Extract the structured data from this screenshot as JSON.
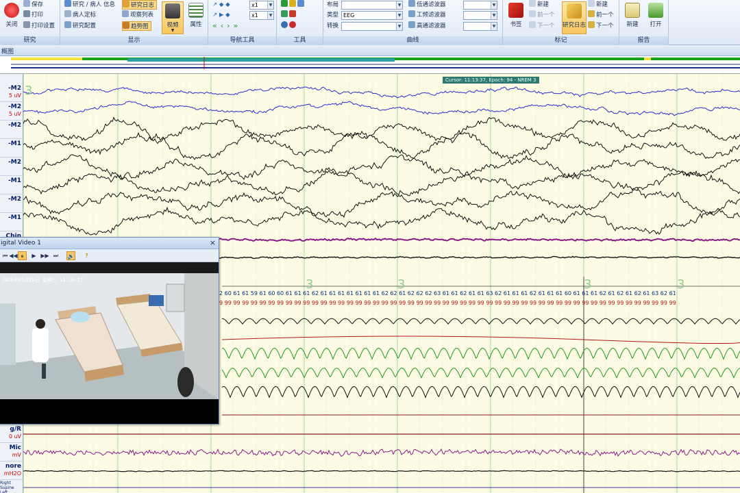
{
  "ribbon": {
    "groups": [
      {
        "label": "研究",
        "items": [
          "关闭",
          "保存",
          "打印",
          "打印设置"
        ]
      },
      {
        "label": "显示",
        "items": [
          "研究 / 病人 信息",
          "病人定标",
          "研究配置",
          "研究日志",
          "观察列表",
          "趋势图",
          "视频",
          "属性"
        ]
      },
      {
        "label": "导航工具",
        "items": [
          "x1",
          "x1"
        ]
      },
      {
        "label": "工具",
        "items": []
      },
      {
        "label": "曲线",
        "items": [
          "布局",
          "类型",
          "EEG",
          "转换",
          "低通滤波器",
          "工频滤波器",
          "高通滤波器"
        ]
      },
      {
        "label": "标记",
        "items": [
          "书签",
          "前一个",
          "下一个",
          "研究日志",
          "新建",
          "前一个",
          "下一个"
        ]
      },
      {
        "label": "报告",
        "items": [
          "新建",
          "打开"
        ]
      }
    ]
  },
  "overview": {
    "label": "概图"
  },
  "cursor_label": "Cursor: 11:13:37, Epoch: 94 - NREM 3",
  "epoch_stage_markers": [
    "3",
    "3",
    "3",
    "3",
    "3"
  ],
  "channels": [
    {
      "name": "-M2",
      "scale": "5 uV"
    },
    {
      "name": "-M2",
      "scale": "5 uV"
    },
    {
      "name": "-M2",
      "scale": ""
    },
    {
      "name": "-M1",
      "scale": ""
    },
    {
      "name": "-M2",
      "scale": ""
    },
    {
      "name": "-M1",
      "scale": ""
    },
    {
      "name": "-M2",
      "scale": ""
    },
    {
      "name": "-M1",
      "scale": ""
    },
    {
      "name": "Chin",
      "scale": ""
    }
  ],
  "lower_channels": [
    {
      "name": "g/R",
      "scale": "0 uV"
    },
    {
      "name": "Mic",
      "scale": "mV"
    },
    {
      "name": "nore",
      "scale": "mH2O"
    },
    {
      "name": "Right Supine Left",
      "scale": ""
    }
  ],
  "spo2_values": "2 60 61 61 59 61 60 60 61 61 61 62 61 61 61 61 61 61 61 62 62 61 62 62 62 63 61 61 62 61 61 63 62 61 61 61 62 61 61 61 60 61 61 61 62 61 62 61 62 61 63 62 61",
  "hr_values": "9 99 99 99 99 99 99 99 99 99 99 99 99 99 99 99 99 99 99 99 99 99 99 99 99 99 99 99 99 99 99 99 99 99 99 99 99 99 99 99 99 99 99 99 99 99 99 99 99 99 99 99 99",
  "video": {
    "title": "igital Video 1",
    "close": "×",
    "osd": "2026年05月20日  星期三  11:10:27",
    "controls": [
      "⏮",
      "◀◀",
      "⏸",
      "▶",
      "▶▶",
      "⏭",
      "🔊",
      "?"
    ]
  },
  "colors": {
    "trace_blue": "#2a2ad8",
    "trace_black": "#111111",
    "trace_purple": "#8a1a8a",
    "trace_green": "#1e9a1e",
    "trace_red": "#b01818",
    "grid_green": "#8fd08f",
    "background": "#fdfbe4"
  }
}
